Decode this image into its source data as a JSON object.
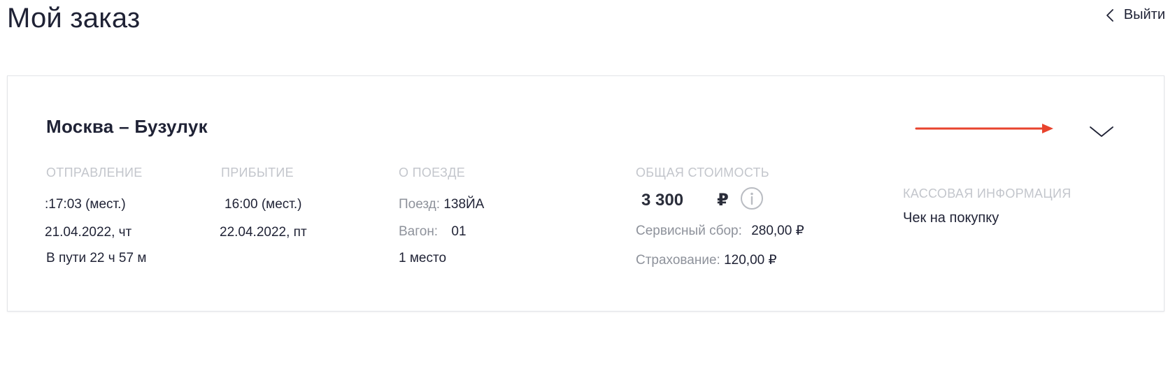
{
  "header": {
    "title": "Мой заказ",
    "logout_label": "Выйти"
  },
  "order": {
    "route": "Москва – Бузулук",
    "departure": {
      "label": "ОТПРАВЛЕНИЕ",
      "time": ":17:03 (мест.)",
      "date": "21.04.2022, чт",
      "duration": "В пути 22 ч 57 м"
    },
    "arrival": {
      "label": "ПРИБЫТИЕ",
      "time": "16:00 (мест.)",
      "date": "22.04.2022, пт"
    },
    "train": {
      "label": "О ПОЕЗДЕ",
      "train_label": "Поезд:",
      "train_number": "138ЙА",
      "car_label": "Вагон:",
      "car_number": "01",
      "seats": "1 место"
    },
    "cost": {
      "label": "ОБЩАЯ СТОИМОСТЬ",
      "total": "3 300",
      "currency": "₽",
      "service_fee_label": "Сервисный сбор:",
      "service_fee_value": "280,00 ₽",
      "insurance_label": "Страхование:",
      "insurance_value": "120,00 ₽"
    },
    "cash_info": {
      "label": "КАССОВАЯ ИНФОРМАЦИЯ",
      "receipt_link": "Чек на покупку"
    }
  },
  "colors": {
    "accent_arrow": "#e8432d",
    "text_primary": "#1f2235",
    "label_muted": "#c3c6cc",
    "text_secondary": "#8e929b"
  },
  "icons": {
    "logout": "chevron-left-icon",
    "expand": "chevron-down-icon",
    "price_info": "info-icon",
    "annotation": "red-arrow-icon"
  }
}
